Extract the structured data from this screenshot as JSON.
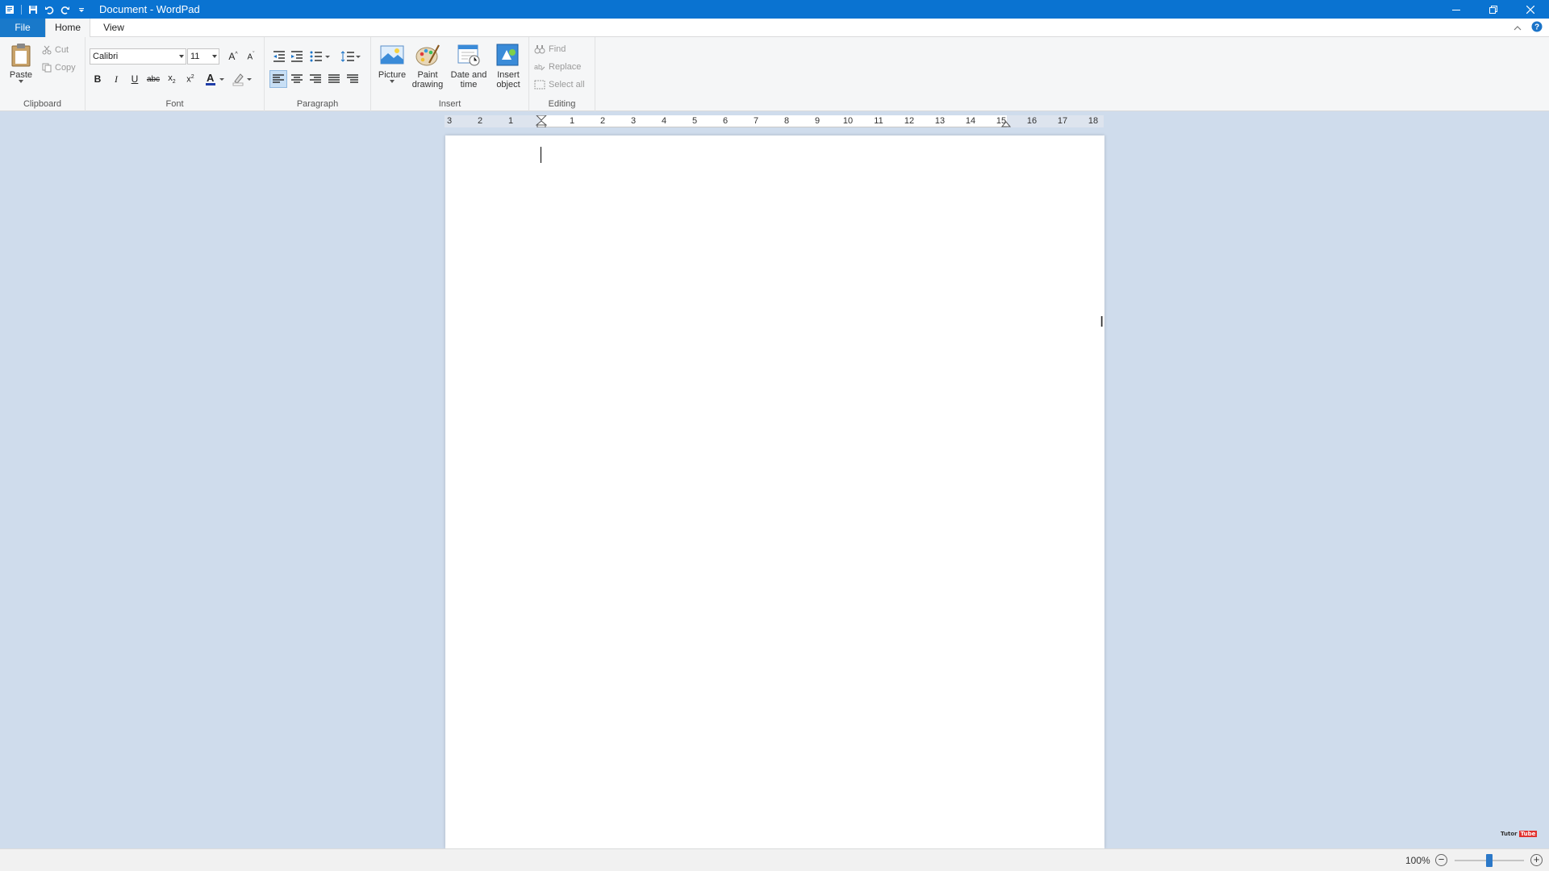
{
  "window": {
    "title": "Document - WordPad",
    "accent_color": "#0a73d1"
  },
  "quick_access": {
    "icons": [
      "app-icon",
      "save-icon",
      "undo-icon",
      "redo-icon",
      "customize-icon"
    ]
  },
  "tabs": {
    "file": "File",
    "home": "Home",
    "view": "View"
  },
  "ribbon": {
    "clipboard": {
      "label": "Clipboard",
      "paste": "Paste",
      "cut": "Cut",
      "copy": "Copy"
    },
    "font": {
      "label": "Font",
      "family": "Calibri",
      "size": "11"
    },
    "paragraph": {
      "label": "Paragraph"
    },
    "insert": {
      "label": "Insert",
      "picture": "Picture",
      "paint_drawing_1": "Paint",
      "paint_drawing_2": "drawing",
      "date_time_1": "Date and",
      "date_time_2": "time",
      "insert_object_1": "Insert",
      "insert_object_2": "object"
    },
    "editing": {
      "label": "Editing",
      "find": "Find",
      "replace": "Replace",
      "select_all": "Select all"
    }
  },
  "ruler": {
    "left_numbers": [
      "3",
      "2",
      "1"
    ],
    "right_numbers": [
      "1",
      "2",
      "3",
      "4",
      "5",
      "6",
      "7",
      "8",
      "9",
      "10",
      "11",
      "12",
      "13",
      "14",
      "15",
      "16",
      "17",
      "18"
    ]
  },
  "statusbar": {
    "zoom": "100%",
    "zoom_fraction": 0.5
  },
  "watermark": {
    "part1": "Tutor",
    "part2": "Tube"
  }
}
